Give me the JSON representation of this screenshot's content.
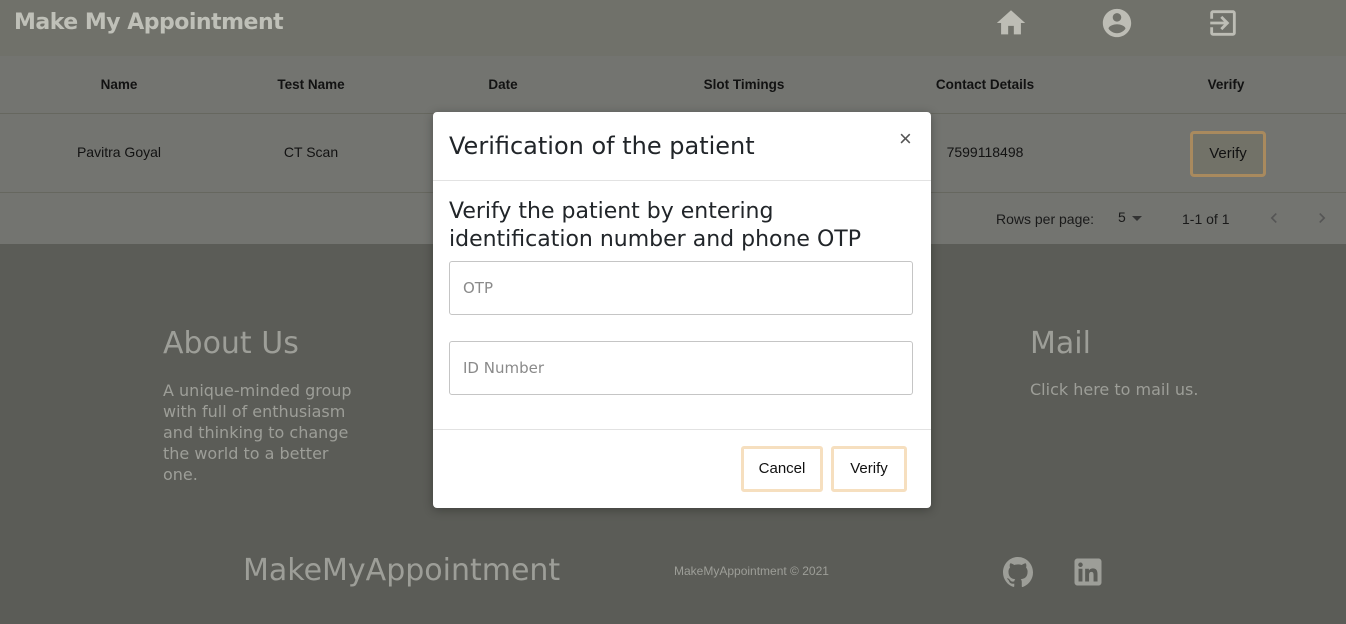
{
  "header": {
    "brand": "Make My Appointment",
    "icons": [
      "home-icon",
      "account-icon",
      "logout-icon"
    ]
  },
  "table": {
    "columns": [
      "Name",
      "Test Name",
      "Date",
      "Slot Timings",
      "Contact Details",
      "Verify"
    ],
    "rows": [
      {
        "name": "Pavitra Goyal",
        "test": "CT Scan",
        "contact": "7599118498",
        "action": "Verify"
      }
    ],
    "footer": {
      "rows_per_page_label": "Rows per page:",
      "rows_per_page_value": "5",
      "range": "1-1 of 1"
    }
  },
  "footer": {
    "about_title": "About Us",
    "about_text": "A unique-minded group with full of enthusiasm and thinking to change the world to a better one.",
    "mail_title": "Mail",
    "mail_link": "Click here to mail us.",
    "brand": "MakeMyAppointment",
    "copyright": "MakeMyAppointment © 2021",
    "social_icons": [
      "github-icon",
      "linkedin-icon"
    ]
  },
  "modal": {
    "title": "Verification of the patient",
    "close": "×",
    "description": "Verify the patient by entering identification number and phone OTP",
    "otp_placeholder": "OTP",
    "otp_value": "",
    "id_placeholder": "ID Number",
    "id_value": "",
    "cancel_label": "Cancel",
    "verify_label": "Verify"
  },
  "colors": {
    "overlay_dark": "#5b5c57",
    "header_bg": "#70716a",
    "table_bg": "#737470",
    "button_border": "#f6dfbf"
  }
}
